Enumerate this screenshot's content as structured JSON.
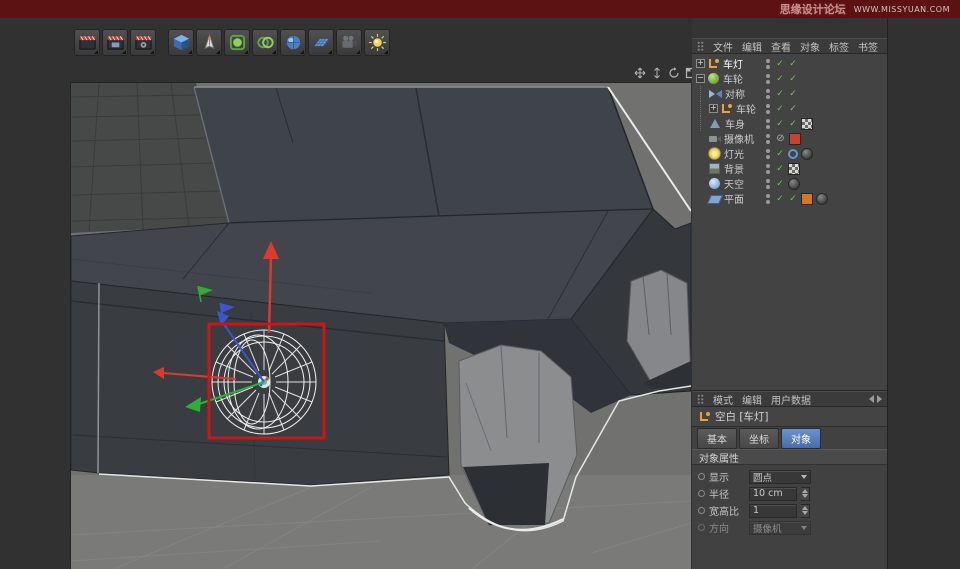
{
  "banner": {
    "title": "思缘设计论坛",
    "url": "WWW.MISSYUAN.COM"
  },
  "toolbar": {
    "tools": [
      {
        "name": "render-view"
      },
      {
        "name": "render-picture-viewer"
      },
      {
        "name": "render-settings"
      },
      {
        "name": "cube-primitive"
      },
      {
        "name": "spline-pen"
      },
      {
        "name": "subdivision-surface"
      },
      {
        "name": "generator"
      },
      {
        "name": "environment"
      },
      {
        "name": "floor"
      },
      {
        "name": "camera"
      },
      {
        "name": "light"
      }
    ]
  },
  "viewport": {
    "controls": [
      "pan",
      "zoom",
      "rotate",
      "maximize"
    ],
    "selection_color": "#cf1414",
    "axis_colors": {
      "x": "#df392c",
      "y": "#2fae35",
      "z": "#3c55cf"
    }
  },
  "object_manager": {
    "menu": [
      "文件",
      "编辑",
      "查看",
      "对象",
      "标签",
      "书签"
    ],
    "items": [
      {
        "label": "车灯",
        "icon": "null-object",
        "expander": "+",
        "depth": 0,
        "checks": 2
      },
      {
        "label": "车轮",
        "icon": "sphere",
        "expander": "−",
        "depth": 0,
        "checks": 2
      },
      {
        "label": "对称",
        "icon": "symmetry",
        "depth": 1,
        "checks": 2
      },
      {
        "label": "车轮",
        "icon": "null-object",
        "expander": "+",
        "depth": 2,
        "checks": 2
      },
      {
        "label": "车身",
        "icon": "polygon",
        "depth": 1,
        "checks": 2,
        "tags": [
          "texture"
        ]
      },
      {
        "label": "摄像机",
        "icon": "camera",
        "depth": 0,
        "state": "protected",
        "tags": [
          "film"
        ]
      },
      {
        "label": "灯光",
        "icon": "light",
        "depth": 0,
        "checks": 2,
        "tags": [
          "target",
          "dark-sphere"
        ]
      },
      {
        "label": "背景",
        "icon": "background",
        "depth": 0,
        "checks": 2,
        "tags": [
          "texture"
        ]
      },
      {
        "label": "天空",
        "icon": "sky",
        "depth": 0,
        "checks": 2,
        "tags": [
          "dark-sphere"
        ]
      },
      {
        "label": "平面",
        "icon": "plane",
        "depth": 0,
        "checks": 2,
        "tags": [
          "orange",
          "dark-sphere"
        ]
      }
    ]
  },
  "attribute_manager": {
    "menu": [
      "模式",
      "编辑",
      "用户数据"
    ],
    "object_title": "空白 [车灯]",
    "tabs": [
      "基本",
      "坐标",
      "对象"
    ],
    "active_tab": "对象",
    "section_title": "对象属性",
    "fields": [
      {
        "label": "显示",
        "value": "圆点",
        "widget": "dropdown"
      },
      {
        "label": "半径",
        "value": "10 cm",
        "widget": "number"
      },
      {
        "label": "宽高比",
        "value": "1",
        "widget": "number"
      },
      {
        "label": "方向",
        "value": "摄像机",
        "widget": "dropdown",
        "disabled": true
      }
    ]
  }
}
